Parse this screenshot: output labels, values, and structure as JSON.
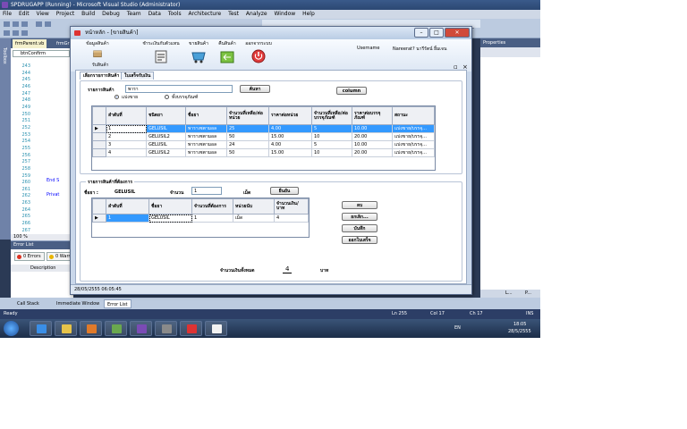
{
  "vs": {
    "title": "SPDRUGAPP (Running) - Microsoft Visual Studio (Administrator)",
    "menu": [
      "File",
      "Edit",
      "View",
      "Project",
      "Build",
      "Debug",
      "Team",
      "Data",
      "Tools",
      "Architecture",
      "Test",
      "Analyze",
      "Window",
      "Help"
    ],
    "toolbar_combo": "dgvShowDetail",
    "doc_tabs": [
      "frmParent.vb",
      "frmGr"
    ],
    "method_combo": "btnConfirm",
    "line_numbers": [
      "243",
      "244",
      "245",
      "246",
      "247",
      "248",
      "249",
      "250",
      "251",
      "252",
      "253",
      "254",
      "255",
      "256",
      "257",
      "258",
      "259",
      "260",
      "261",
      "262",
      "263",
      "264",
      "265",
      "266",
      "267"
    ],
    "code_lines": [
      {
        "text": "End S",
        "line": 260
      },
      {
        "text": "Privat",
        "line": 262
      }
    ],
    "zoom": "100 %",
    "properties_title": "Properties",
    "error_list_title": "Error List",
    "errors_button": "0 Errors",
    "warnings_button": "0 Warni",
    "description_header": "Description",
    "bottom_tabs": [
      "Call Stack",
      "Immediate Window",
      "Error List"
    ],
    "props_tabs": [
      "L...",
      "P..."
    ],
    "status": {
      "ready": "Ready",
      "ln": "Ln 255",
      "col": "Col 17",
      "ch": "Ch 17",
      "ins": "INS"
    },
    "tray": {
      "lang": "EN",
      "time": "18:05",
      "date": "28/5/2555"
    }
  },
  "app": {
    "title": "หน้าหลัก - [ขายสินค้า]",
    "ribbon": [
      {
        "label": "ข้อมูลสินค้า",
        "sublabel": "รับสินค้า",
        "icon": "box-icon"
      },
      {
        "label": "ชำระเงินกับตัวแทน",
        "icon": "report-icon"
      },
      {
        "label": "ขายสินค้า",
        "icon": "cart-icon"
      },
      {
        "label": "คืนสินค้า",
        "icon": "return-icon"
      },
      {
        "label": "ออกจากระบบ",
        "icon": "power-icon"
      }
    ],
    "user_label": "Username",
    "user_name": "Nareerat? นารีรัตน์ ยิ้มเจน",
    "tabs": [
      "เลือกรายการสินค้า",
      "ใบเสร็จรับเงิน"
    ],
    "search": {
      "label": "รายการสินค้า",
      "value": "พารา",
      "search_button": "ค้นหา",
      "column_button": "column",
      "radio_retail": "แบ่งขาย",
      "radio_box": "ทั้งบรรจุภัณฑ์"
    },
    "grid1": {
      "headers": [
        "ลำดับที่",
        "ชนิดยา",
        "ชื่อยา",
        "จำนวนที่เหลือ/ต่อหน่วย",
        "ราคาต่อหน่วย",
        "จำนวนที่เหลือ/ต่อบรรจุภัณฑ์",
        "ราคาต่อบรรจุภัณฑ์",
        "สถานะ"
      ],
      "rows": [
        [
          "1",
          "GELUSIL",
          "พาราเซตามอล",
          "25",
          "4.00",
          "5",
          "10.00",
          "แบ่งขาย/บรรจุ..."
        ],
        [
          "2",
          "GELUSIL2",
          "พาราเซตามอล",
          "50",
          "15.00",
          "10",
          "20.00",
          "แบ่งขาย/บรรจุ..."
        ],
        [
          "3",
          "GELUSIL",
          "พาราเซตามอล",
          "24",
          "4.00",
          "5",
          "10.00",
          "แบ่งขาย/บรรจุ..."
        ],
        [
          "4",
          "GELUSIL2",
          "พาราเซตามอล",
          "50",
          "15.00",
          "10",
          "20.00",
          "แบ่งขาย/บรรจุ..."
        ]
      ]
    },
    "order": {
      "group_title": "รายการสินค้าที่ต้องการ",
      "drug_label": "ชื่อยา :",
      "drug_value": "GELUSIL",
      "qty_label": "จำนวน",
      "qty_value": "1",
      "unit": "เม็ด",
      "confirm_button": "ยืนยัน"
    },
    "grid2": {
      "headers": [
        "ลำดับที่",
        "ชื่อยา",
        "จำนวนที่ต้องการ",
        "หน่วยนับ",
        "จำนวนเงิน/บาท"
      ],
      "rows": [
        [
          "1",
          "GELUSIL",
          "1",
          "เม็ด",
          "4"
        ]
      ]
    },
    "side_buttons": [
      "ลบ",
      "ยกเลิก...",
      "บันทึก",
      "ออกใบเสร็จ"
    ],
    "total_label": "จำนวนเงินทั้งหมด",
    "total_value": "4",
    "currency": "บาท",
    "status_time": "28/05/2555  06:05:45"
  }
}
